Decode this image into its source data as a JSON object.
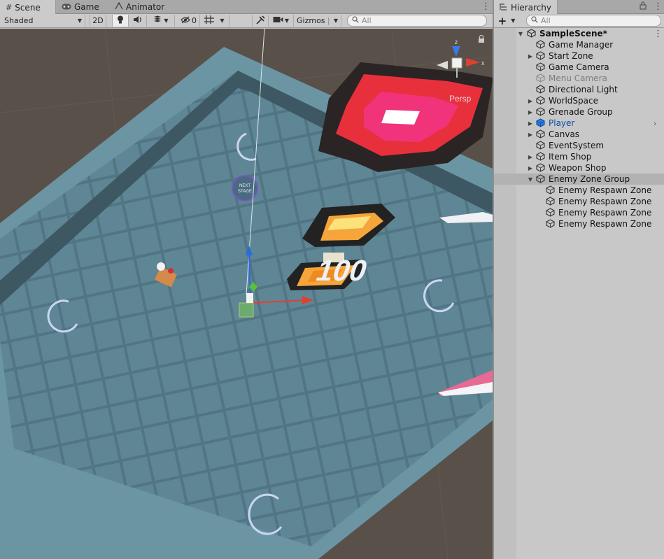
{
  "scene_panel": {
    "tabs": [
      {
        "label": "Scene",
        "icon": "grid-icon",
        "active": true
      },
      {
        "label": "Game",
        "icon": "gamepad-icon",
        "active": false
      },
      {
        "label": "Animator",
        "icon": "animator-icon",
        "active": false
      }
    ],
    "toolbar": {
      "shading_mode": "Shaded",
      "mode_2d": "2D",
      "hidden_count": "0",
      "gizmos_label": "Gizmos",
      "search_placeholder": "All"
    },
    "viewport": {
      "persp_label": "Persp",
      "axis_x": "x",
      "axis_z": "z",
      "next_stage_line1": "NEXT",
      "next_stage_line2": "STAGE",
      "score_text": "100"
    }
  },
  "hierarchy": {
    "tab_label": "Hierarchy",
    "add_label": "+",
    "search_placeholder": "All",
    "scene_name": "SampleScene*",
    "items": [
      {
        "label": "Game Manager",
        "depth": 1,
        "foldable": false,
        "state": "normal"
      },
      {
        "label": "Start Zone",
        "depth": 1,
        "foldable": true,
        "state": "normal"
      },
      {
        "label": "Game Camera",
        "depth": 1,
        "foldable": false,
        "state": "normal"
      },
      {
        "label": "Menu Camera",
        "depth": 1,
        "foldable": false,
        "state": "disabled"
      },
      {
        "label": "Directional Light",
        "depth": 1,
        "foldable": false,
        "state": "normal"
      },
      {
        "label": "WorldSpace",
        "depth": 1,
        "foldable": true,
        "state": "normal"
      },
      {
        "label": "Grenade Group",
        "depth": 1,
        "foldable": true,
        "state": "normal"
      },
      {
        "label": "Player",
        "depth": 1,
        "foldable": true,
        "state": "prefab"
      },
      {
        "label": "Canvas",
        "depth": 1,
        "foldable": true,
        "state": "normal"
      },
      {
        "label": "EventSystem",
        "depth": 1,
        "foldable": false,
        "state": "normal"
      },
      {
        "label": "Item Shop",
        "depth": 1,
        "foldable": true,
        "state": "normal"
      },
      {
        "label": "Weapon Shop",
        "depth": 1,
        "foldable": true,
        "state": "normal"
      },
      {
        "label": "Enemy Zone Group",
        "depth": 1,
        "foldable": true,
        "expanded": true,
        "state": "selected"
      },
      {
        "label": "Enemy Respawn Zone",
        "depth": 2,
        "foldable": false,
        "state": "normal"
      },
      {
        "label": "Enemy Respawn Zone",
        "depth": 2,
        "foldable": false,
        "state": "normal"
      },
      {
        "label": "Enemy Respawn Zone",
        "depth": 2,
        "foldable": false,
        "state": "normal"
      },
      {
        "label": "Enemy Respawn Zone",
        "depth": 2,
        "foldable": false,
        "state": "normal"
      }
    ]
  },
  "colors": {
    "ground": "#585049",
    "floor": "#5f8695",
    "wall": "#3e5863",
    "accent_red": "#e8303c",
    "accent_pink": "#f0337a",
    "accent_orange": "#f6a53a",
    "prefab_blue": "#0d4ea6"
  }
}
